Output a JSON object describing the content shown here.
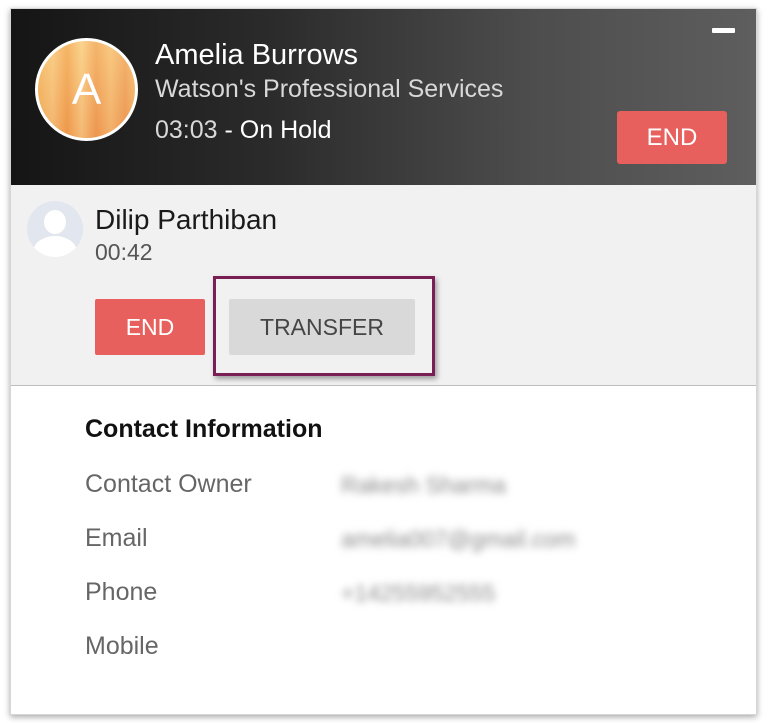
{
  "active_call": {
    "avatar_letter": "A",
    "name": "Amelia Burrows",
    "company": "Watson's Professional Services",
    "duration": "03:03",
    "status": "- On Hold",
    "end_label": "END"
  },
  "second_call": {
    "name": "Dilip Parthiban",
    "duration": "00:42",
    "end_label": "END",
    "transfer_label": "TRANSFER"
  },
  "contact_info": {
    "title": "Contact Information",
    "rows": [
      {
        "label": "Contact Owner",
        "value": "Rakesh Sharma"
      },
      {
        "label": "Email",
        "value": "amelia007@gmail.com"
      },
      {
        "label": "Phone",
        "value": "+14255952555"
      },
      {
        "label": "Mobile",
        "value": ""
      }
    ]
  },
  "colors": {
    "end_button": "#e8605e",
    "transfer_button": "#d9d9d9",
    "highlight_border": "#7a1f55"
  },
  "icons": [
    "minimize-icon",
    "caller-avatar",
    "user-avatar-placeholder-icon"
  ]
}
